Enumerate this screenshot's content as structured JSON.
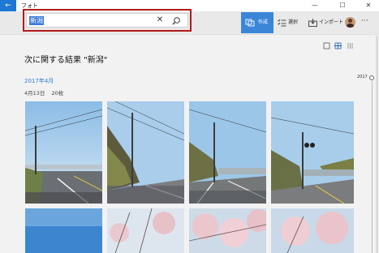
{
  "window": {
    "title": "フォト",
    "back_glyph": "←",
    "minimize_glyph": "—",
    "maximize_glyph": "☐",
    "close_glyph": "✕"
  },
  "search": {
    "value": "新潟",
    "clear_glyph": "✕"
  },
  "toolbar": {
    "create_label": "作成",
    "select_label": "選択",
    "import_label": "インポート",
    "more_glyph": "···"
  },
  "results": {
    "heading": "次に関する結果 \"新潟\"",
    "month": "2017年4月",
    "date": "4月13日",
    "count": "20枚"
  },
  "timeline": {
    "year": "2017"
  },
  "colors": {
    "accent": "#3b86d8",
    "search_outline": "#b31b1b",
    "link": "#2e7bd6"
  },
  "icons": [
    "back-arrow-icon",
    "clear-icon",
    "search-icon",
    "create-icon",
    "select-icon",
    "import-icon",
    "avatar",
    "more-icon",
    "single-view-icon",
    "grid-view-icon",
    "list-view-icon"
  ]
}
